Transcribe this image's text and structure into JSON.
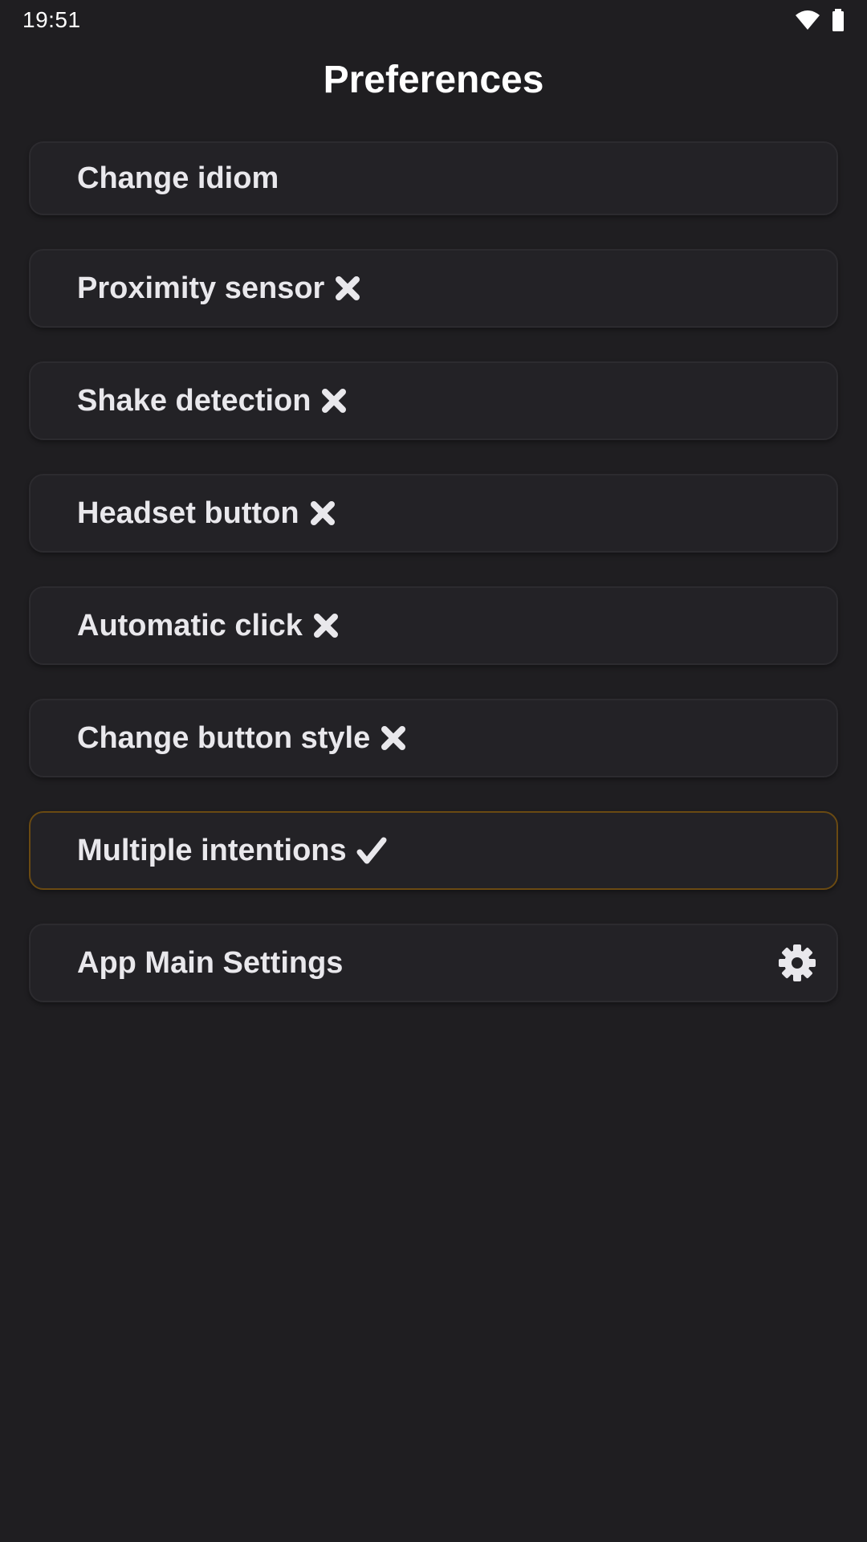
{
  "status_bar": {
    "time": "19:51",
    "icons": [
      "wifi-icon",
      "battery-icon"
    ]
  },
  "page": {
    "title": "Preferences"
  },
  "preferences": [
    {
      "label": "Change idiom",
      "state": "none"
    },
    {
      "label": "Proximity sensor",
      "state": "off",
      "state_icon": "cross-icon"
    },
    {
      "label": "Shake detection",
      "state": "off",
      "state_icon": "cross-icon"
    },
    {
      "label": "Headset button",
      "state": "off",
      "state_icon": "cross-icon"
    },
    {
      "label": "Automatic click",
      "state": "off",
      "state_icon": "cross-icon"
    },
    {
      "label": "Change button style",
      "state": "off",
      "state_icon": "cross-icon"
    },
    {
      "label": "Multiple intentions",
      "state": "on",
      "state_icon": "check-icon"
    },
    {
      "label": "App Main Settings",
      "state": "none",
      "trailing_icon": "gear-icon"
    }
  ],
  "colors": {
    "background": "#1f1e21",
    "card": "#232226",
    "card_border": "#2c2b2f",
    "active_border": "#6a4a12",
    "text": "#e9e8ec"
  }
}
